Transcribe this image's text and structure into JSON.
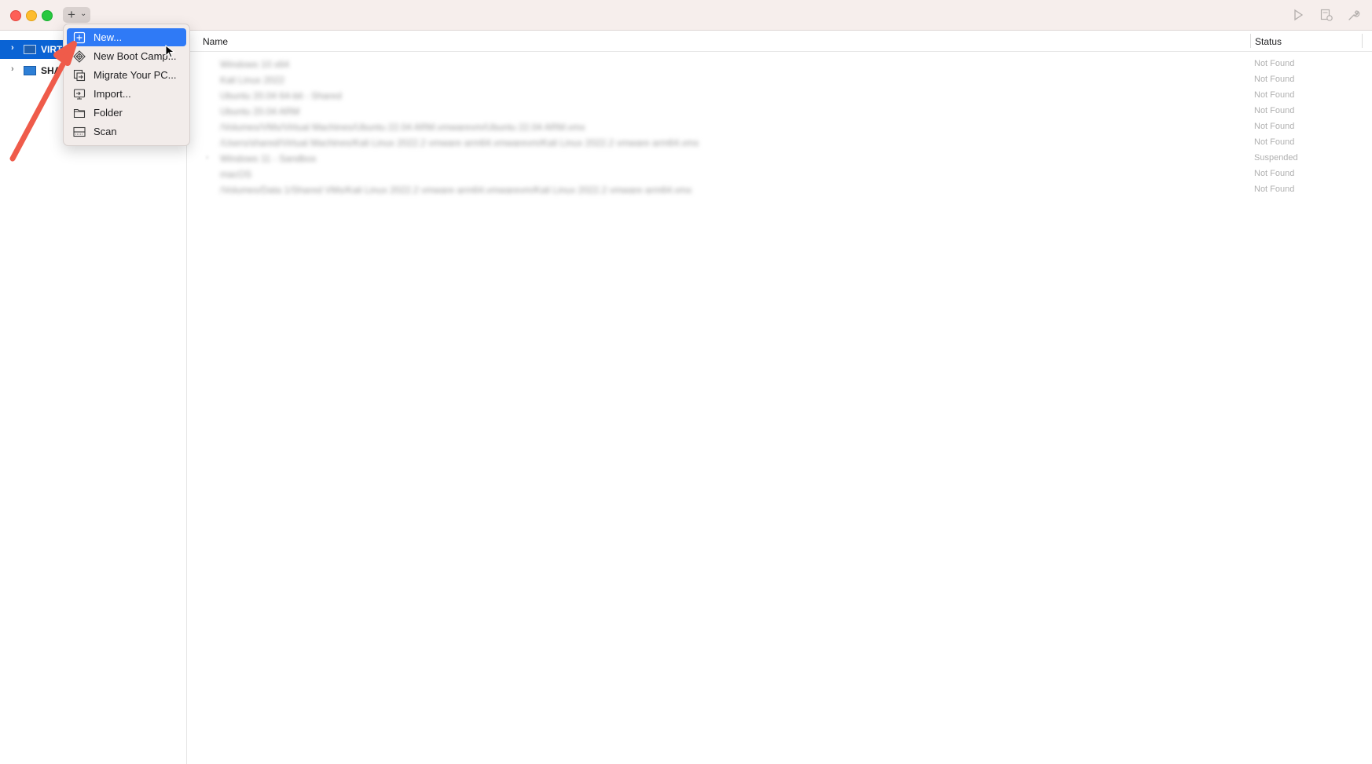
{
  "toolbar": {
    "add_icon": "plus-icon",
    "add_chevron_icon": "chevron-down-icon",
    "right_icons": [
      "play-icon",
      "snapshot-icon",
      "wrench-icon"
    ]
  },
  "sidebar": {
    "items": [
      {
        "label": "VIRT",
        "icon": "computer-icon",
        "selected": true
      },
      {
        "label": "SHA",
        "icon": "computer-icon",
        "selected": false
      }
    ]
  },
  "table": {
    "columns": {
      "name": "Name",
      "status": "Status"
    },
    "rows": [
      {
        "name": "Windows 10 x64",
        "status": "Not Found"
      },
      {
        "name": "Kali Linux 2022",
        "status": "Not Found"
      },
      {
        "name": "Ubuntu 20.04 64-bit - Shared",
        "status": "Not Found"
      },
      {
        "name": "Ubuntu 20.04 ARM",
        "status": "Not Found"
      },
      {
        "name": "/Volumes/VMs/Virtual Machines/Ubuntu 22.04 ARM.vmwarevm/Ubuntu 22.04 ARM.vmx",
        "status": "Not Found"
      },
      {
        "name": "/Users/shared/Virtual Machines/Kali Linux 2022.2 vmware arm64.vmwarevm/Kali Linux 2022.2 vmware arm64.vmx",
        "status": "Not Found"
      },
      {
        "name": "Windows 11 - Sandbox",
        "status": "Suspended"
      },
      {
        "name": "macOS",
        "status": "Not Found"
      },
      {
        "name": "/Volumes/Data 1/Shared VMs/Kali Linux 2022.2 vmware arm64.vmwarevm/Kali Linux 2022.2 vmware arm64.vmx",
        "status": "Not Found"
      }
    ]
  },
  "menu": {
    "items": [
      {
        "label": "New...",
        "icon": "new-vm-icon",
        "active": true
      },
      {
        "label": "New Boot Camp...",
        "icon": "bootcamp-icon",
        "active": false
      },
      {
        "label": "Migrate Your PC...",
        "icon": "migrate-icon",
        "active": false
      },
      {
        "label": "Import...",
        "icon": "import-icon",
        "active": false
      },
      {
        "label": "Folder",
        "icon": "folder-icon",
        "active": false
      },
      {
        "label": "Scan",
        "icon": "scan-icon",
        "active": false
      }
    ]
  },
  "annotation": {
    "arrow_color": "#ef5b4a",
    "icon": "annotation-arrow-icon"
  },
  "colors": {
    "selection": "#0a63d4",
    "menu_highlight": "#2f7af6",
    "titlebar": "#f6eeec"
  }
}
